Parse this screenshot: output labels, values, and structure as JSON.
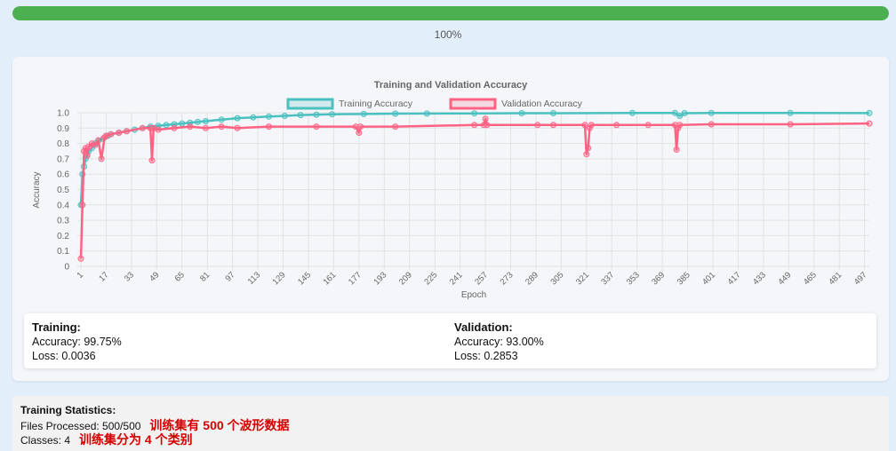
{
  "progress": {
    "percent": 100,
    "label": "100%"
  },
  "chart_data": {
    "type": "line",
    "title": "Training and Validation Accuracy",
    "xlabel": "Epoch",
    "ylabel": "Accuracy",
    "ylim": [
      0,
      1
    ],
    "yticks": [
      "0",
      "0.1",
      "0.2",
      "0.3",
      "0.4",
      "0.5",
      "0.6",
      "0.7",
      "0.8",
      "0.9",
      "1.0"
    ],
    "xticks": [
      1,
      17,
      33,
      49,
      65,
      81,
      97,
      113,
      129,
      145,
      161,
      177,
      193,
      209,
      225,
      241,
      257,
      273,
      289,
      305,
      321,
      337,
      353,
      369,
      385,
      401,
      417,
      433,
      449,
      465,
      481,
      497
    ],
    "x_range": [
      1,
      500
    ],
    "grid": true,
    "legend": "top-center",
    "series": [
      {
        "name": "Training Accuracy",
        "color": "#4bc0c0",
        "x": [
          1,
          2,
          3,
          4,
          5,
          6,
          8,
          10,
          12,
          15,
          18,
          20,
          25,
          30,
          35,
          40,
          45,
          50,
          55,
          60,
          65,
          70,
          75,
          80,
          90,
          100,
          110,
          120,
          130,
          140,
          150,
          160,
          180,
          200,
          220,
          250,
          280,
          300,
          350,
          377,
          380,
          383,
          400,
          450,
          500
        ],
        "values": [
          0.4,
          0.6,
          0.65,
          0.7,
          0.73,
          0.75,
          0.77,
          0.8,
          0.82,
          0.83,
          0.85,
          0.86,
          0.87,
          0.88,
          0.89,
          0.9,
          0.91,
          0.915,
          0.92,
          0.925,
          0.93,
          0.935,
          0.94,
          0.945,
          0.955,
          0.965,
          0.97,
          0.975,
          0.98,
          0.985,
          0.988,
          0.99,
          0.992,
          0.994,
          0.995,
          0.996,
          0.997,
          0.997,
          0.998,
          0.998,
          0.98,
          0.997,
          0.998,
          0.998,
          0.9975
        ]
      },
      {
        "name": "Validation Accuracy",
        "color": "#ff6384",
        "x": [
          1,
          2,
          3,
          4,
          5,
          6,
          8,
          10,
          12,
          14,
          16,
          17,
          20,
          25,
          30,
          40,
          45,
          46,
          47,
          50,
          60,
          70,
          80,
          90,
          100,
          120,
          150,
          175,
          177,
          178,
          200,
          250,
          256,
          257,
          258,
          290,
          300,
          320,
          321,
          322,
          323,
          324,
          340,
          360,
          377,
          378,
          379,
          380,
          400,
          450,
          500
        ],
        "values": [
          0.05,
          0.4,
          0.75,
          0.77,
          0.72,
          0.78,
          0.8,
          0.79,
          0.82,
          0.7,
          0.84,
          0.85,
          0.86,
          0.87,
          0.88,
          0.9,
          0.9,
          0.69,
          0.9,
          0.89,
          0.9,
          0.91,
          0.9,
          0.91,
          0.9,
          0.91,
          0.91,
          0.91,
          0.87,
          0.91,
          0.91,
          0.92,
          0.92,
          0.96,
          0.92,
          0.92,
          0.92,
          0.92,
          0.73,
          0.77,
          0.9,
          0.92,
          0.92,
          0.92,
          0.92,
          0.76,
          0.9,
          0.92,
          0.925,
          0.925,
          0.93
        ]
      }
    ]
  },
  "stats": {
    "training": {
      "header": "Training:",
      "accuracy": "Accuracy: 99.75%",
      "loss": "Loss: 0.0036"
    },
    "validation": {
      "header": "Validation:",
      "accuracy": "Accuracy: 93.00%",
      "loss": "Loss: 0.2853"
    }
  },
  "training_statistics": {
    "title": "Training Statistics:",
    "files": "Files Processed: 500/500",
    "files_note": "训练集有 500 个波形数据",
    "classes": "Classes: 4",
    "classes_note": "训练集分为 4 个类别"
  }
}
